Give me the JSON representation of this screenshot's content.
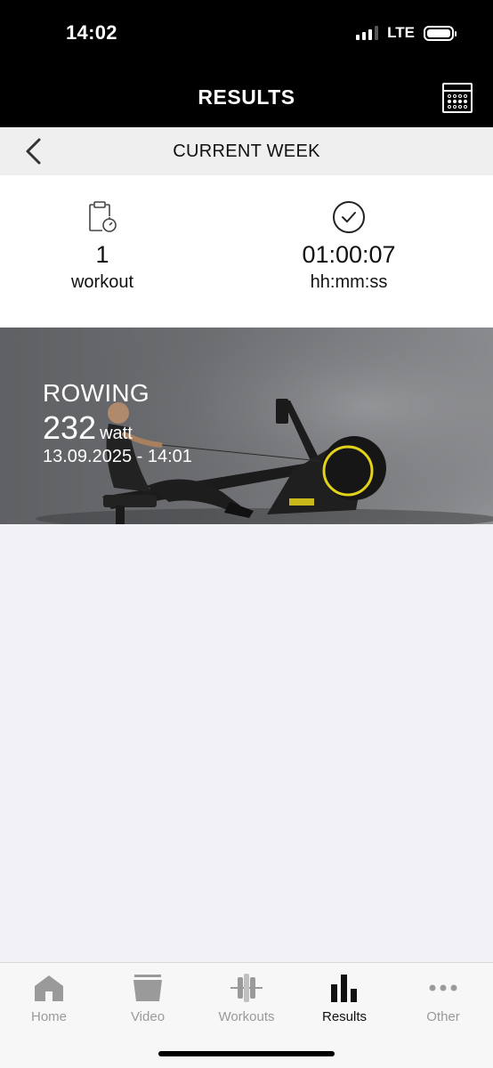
{
  "status_bar": {
    "time": "14:02",
    "network": "LTE"
  },
  "header": {
    "title": "RESULTS"
  },
  "week_nav": {
    "title": "CURRENT WEEK"
  },
  "summary": {
    "workouts": {
      "value": "1",
      "unit": "workout"
    },
    "duration": {
      "value": "01:00:07",
      "unit": "hh:mm:ss"
    }
  },
  "workouts": [
    {
      "type": "ROWING",
      "power": "232",
      "power_unit": "watt",
      "date": "13.09.2025 - 14:01",
      "accent": "#e2d21a"
    }
  ],
  "tabbar": {
    "items": [
      {
        "label": "Home",
        "icon": "home-icon",
        "active": false
      },
      {
        "label": "Video",
        "icon": "video-icon",
        "active": false
      },
      {
        "label": "Workouts",
        "icon": "workouts-icon",
        "active": false
      },
      {
        "label": "Results",
        "icon": "results-icon",
        "active": true
      },
      {
        "label": "Other",
        "icon": "more-icon",
        "active": false
      }
    ]
  },
  "colors": {
    "header_bg": "#000000",
    "active_tab": "#111111",
    "inactive_tab": "#9a9a9a"
  }
}
